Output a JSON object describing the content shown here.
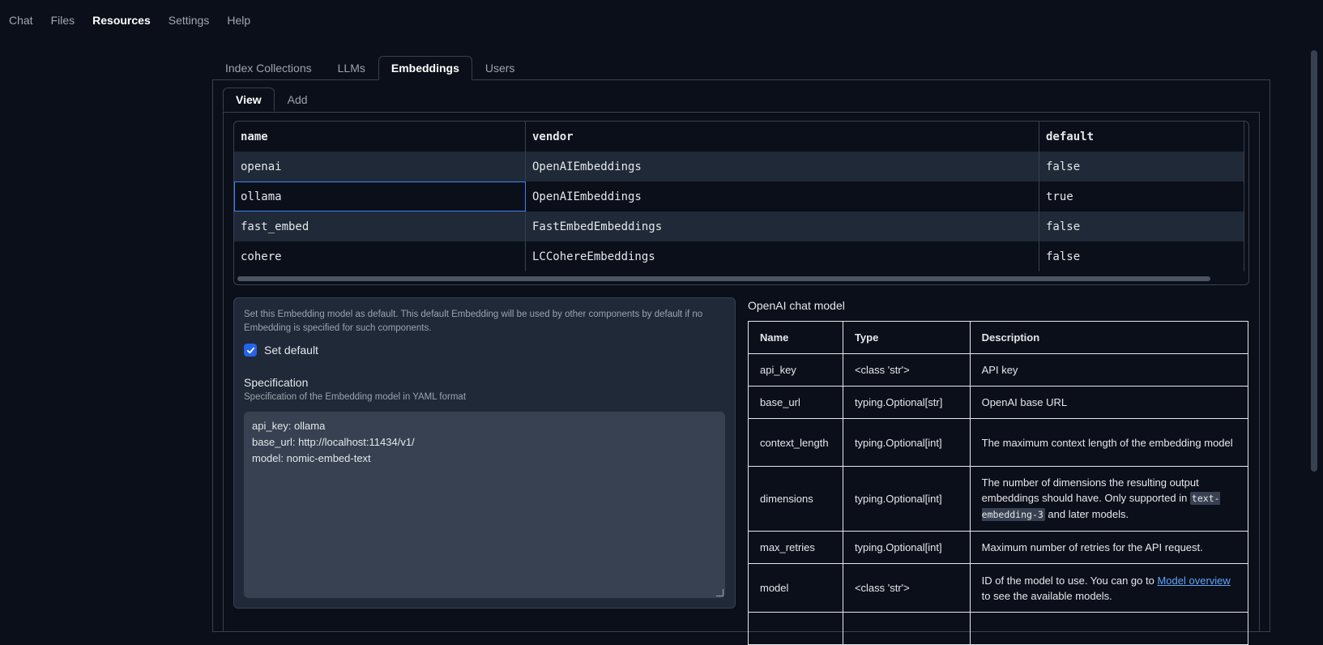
{
  "nav": {
    "items": [
      {
        "label": "Chat",
        "active": false
      },
      {
        "label": "Files",
        "active": false
      },
      {
        "label": "Resources",
        "active": true
      },
      {
        "label": "Settings",
        "active": false
      },
      {
        "label": "Help",
        "active": false
      }
    ]
  },
  "resource_tabs": [
    "Index Collections",
    "LLMs",
    "Embeddings",
    "Users"
  ],
  "resource_active": "Embeddings",
  "view_tabs": [
    "View",
    "Add"
  ],
  "view_active": "View",
  "embeddings_table": {
    "columns": [
      "name",
      "vendor",
      "default"
    ],
    "rows": [
      {
        "name": "openai",
        "vendor": "OpenAIEmbeddings",
        "default": "false"
      },
      {
        "name": "ollama",
        "vendor": "OpenAIEmbeddings",
        "default": "true"
      },
      {
        "name": "fast_embed",
        "vendor": "FastEmbedEmbeddings",
        "default": "false"
      },
      {
        "name": "cohere",
        "vendor": "LCCohereEmbeddings",
        "default": "false"
      }
    ]
  },
  "settings": {
    "info": "Set this Embedding model as default. This default Embedding will be used by other components by default if no Embedding is specified for such components.",
    "set_default_label": "Set default",
    "set_default_checked": true,
    "spec_title": "Specification",
    "spec_subtitle": "Specification of the Embedding model in YAML format",
    "spec_lines": [
      "api_key: ollama",
      "base_url: http://localhost:11434/v1/",
      "model: nomic-embed-text"
    ]
  },
  "params": {
    "title": "OpenAI chat model",
    "headers": [
      "Name",
      "Type",
      "Description"
    ],
    "rows": [
      {
        "name": "api_key",
        "type": "<class 'str'>",
        "desc": "API key"
      },
      {
        "name": "base_url",
        "type": "typing.Optional[str]",
        "desc": "OpenAI base URL"
      },
      {
        "name": "context_length",
        "type": "typing.Optional[int]",
        "desc": "The maximum context length of the embedding model"
      },
      {
        "name": "dimensions",
        "type": "typing.Optional[int]",
        "desc_pre": "The number of dimensions the resulting output embeddings should have. Only supported in ",
        "desc_code": "text-embedding-3",
        "desc_post": " and later models."
      },
      {
        "name": "max_retries",
        "type": "typing.Optional[int]",
        "desc": "Maximum number of retries for the API request."
      },
      {
        "name": "model",
        "type": "<class 'str'>",
        "desc_pre": "ID of the model to use. You can go to ",
        "desc_link": "Model overview",
        "desc_post": " to see the available models."
      }
    ]
  }
}
